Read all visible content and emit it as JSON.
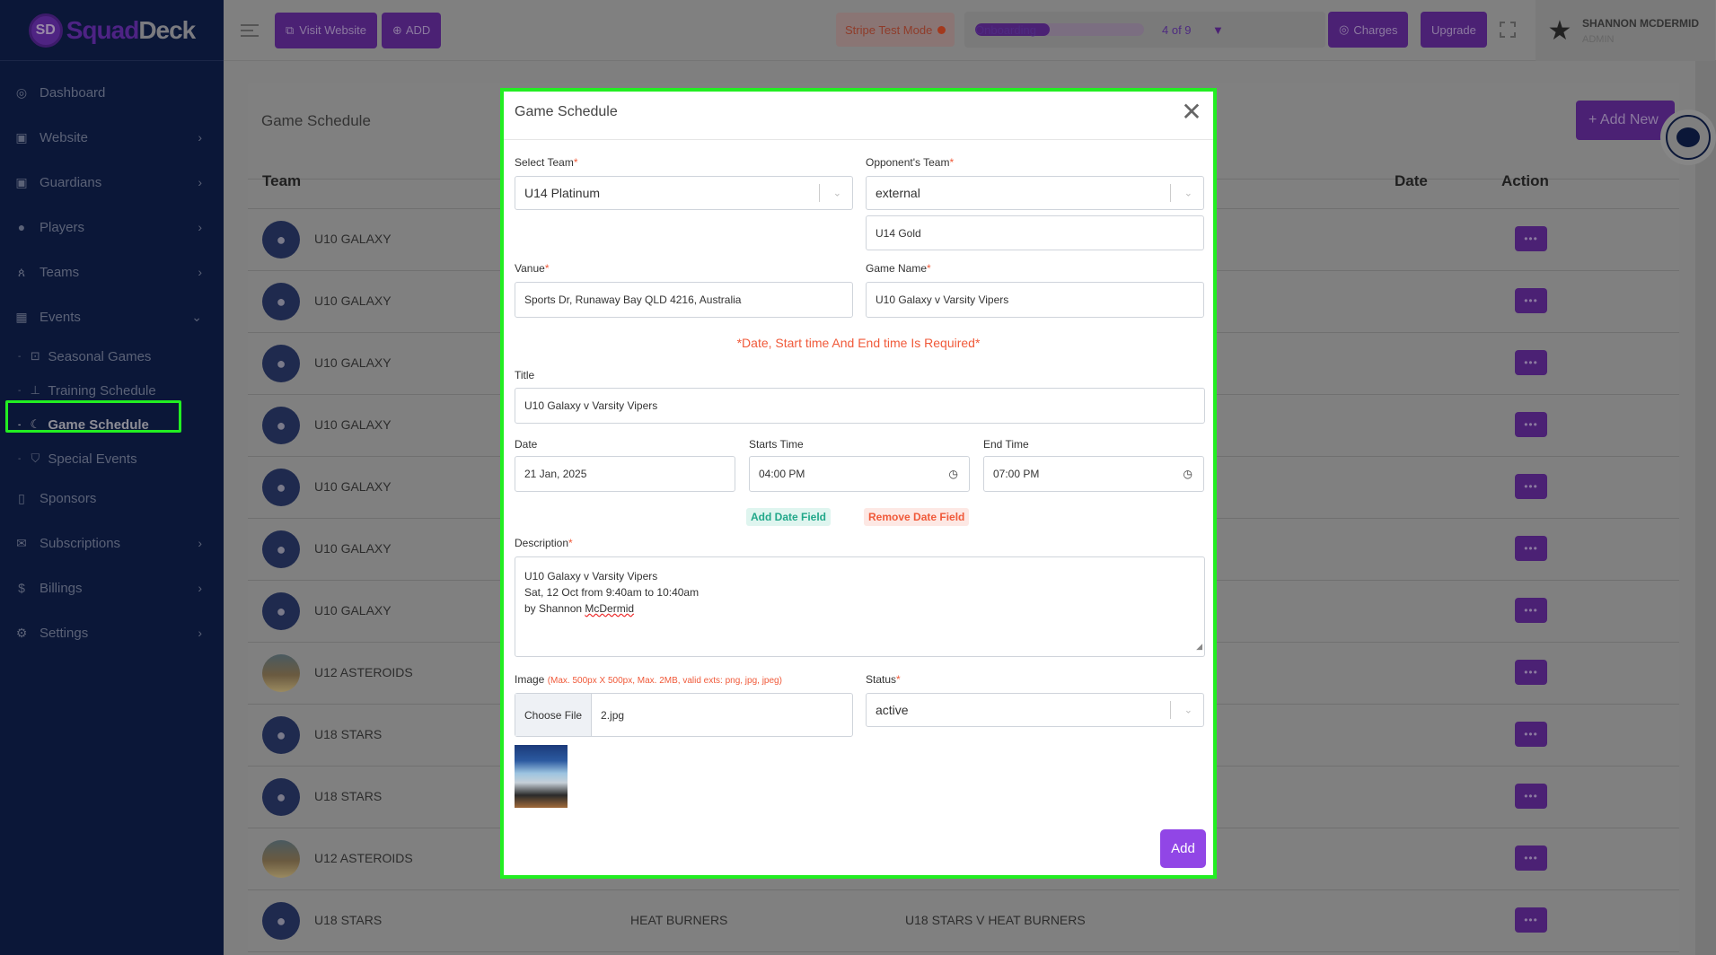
{
  "sidebar": {
    "logo": {
      "mark": "SD",
      "brand_part1": "Squad",
      "brand_part2": "Deck"
    },
    "items": [
      {
        "label": "Dashboard",
        "icon": "gauge-icon",
        "glyph": "◎",
        "chevron": ""
      },
      {
        "label": "Website",
        "icon": "layout-icon",
        "glyph": "▣",
        "chevron": "›"
      },
      {
        "label": "Guardians",
        "icon": "layout-icon",
        "glyph": "▣",
        "chevron": "›"
      },
      {
        "label": "Players",
        "icon": "user-icon",
        "glyph": "●",
        "chevron": "›"
      },
      {
        "label": "Teams",
        "icon": "team-icon",
        "glyph": "ጰ",
        "chevron": "›"
      },
      {
        "label": "Events",
        "icon": "calendar-icon",
        "glyph": "▦",
        "chevron": "⌄"
      }
    ],
    "sub_items": [
      {
        "label": "Seasonal Games",
        "glyph": "⊡",
        "active": false
      },
      {
        "label": "Training Schedule",
        "glyph": "⊥",
        "active": false
      },
      {
        "label": "Game Schedule",
        "glyph": "☾",
        "active": true
      },
      {
        "label": "Special Events",
        "glyph": "⛉",
        "active": false
      }
    ],
    "items_after": [
      {
        "label": "Sponsors",
        "glyph": "▯",
        "chevron": ""
      },
      {
        "label": "Subscriptions",
        "glyph": "✉",
        "chevron": "›"
      },
      {
        "label": "Billings",
        "glyph": "$",
        "chevron": "›"
      },
      {
        "label": "Settings",
        "glyph": "⚙",
        "chevron": "›"
      }
    ],
    "sub_dash": "-"
  },
  "topbar": {
    "visit_website": "Visit Website",
    "visit_icon": "⧉",
    "add": "ADD",
    "add_icon": "⊕",
    "stripe_mode": "Stripe Test Mode",
    "onboarding_label": "Onboarding",
    "onboarding_progress": 0.44,
    "onboarding_count": "4 of 9",
    "onboarding_toggle": "▼",
    "charges": "Charges",
    "charges_icon": "◎",
    "upgrade": "Upgrade",
    "user_name": "SHANNON MCDERMID",
    "user_role": "ADMIN",
    "user_avatar": "★"
  },
  "page": {
    "title": "Game Schedule",
    "add_new": "+  Add New",
    "columns": {
      "team": "Team",
      "date": "Date",
      "action": "Action"
    },
    "action_label": "•••",
    "rows": [
      {
        "team": "U10 GALAXY",
        "opponent": "",
        "game": "",
        "photo": false
      },
      {
        "team": "U10 GALAXY",
        "opponent": "",
        "game": "",
        "photo": false
      },
      {
        "team": "U10 GALAXY",
        "opponent": "",
        "game": "",
        "photo": false
      },
      {
        "team": "U10 GALAXY",
        "opponent": "",
        "game": "",
        "photo": false
      },
      {
        "team": "U10 GALAXY",
        "opponent": "",
        "game": "",
        "photo": false
      },
      {
        "team": "U10 GALAXY",
        "opponent": "",
        "game": "",
        "photo": false
      },
      {
        "team": "U10 GALAXY",
        "opponent": "",
        "game": "",
        "photo": false
      },
      {
        "team": "U12 ASTEROIDS",
        "opponent": "",
        "game": "",
        "photo": true
      },
      {
        "team": "U18 STARS",
        "opponent": "",
        "game": "",
        "photo": false
      },
      {
        "team": "U18 STARS",
        "opponent": "",
        "game": "",
        "photo": false
      },
      {
        "team": "U12 ASTEROIDS",
        "opponent": "",
        "game": "",
        "photo": true
      },
      {
        "team": "U18 STARS",
        "opponent": "HEAT BURNERS",
        "game": "U18 STARS V HEAT BURNERS",
        "photo": false
      }
    ]
  },
  "modal": {
    "title": "Game Schedule",
    "close": "✕",
    "select_team_label": "Select Team",
    "select_team_value": "U14 Platinum",
    "opponent_label": "Opponent's Team",
    "opponent_value": "external",
    "opponent_name_value": "U14 Gold",
    "venue_label": "Vanue",
    "venue_value": "Sports Dr, Runaway Bay QLD 4216, Australia",
    "game_name_label": "Game Name",
    "game_name_value": "U10 Galaxy v Varsity Vipers",
    "error": "*Date, Start time And End time Is Required*",
    "title_label": "Title",
    "title_value": "U10 Galaxy v Varsity Vipers",
    "date_label": "Date",
    "date_value": "21 Jan, 2025",
    "start_label": "Starts Time",
    "start_value": "04:00  PM",
    "end_label": "End Time",
    "end_value": "07:00  PM",
    "add_date": "Add Date Field",
    "remove_date": "Remove Date Field",
    "description_label": "Description",
    "description_lines": [
      "U10 Galaxy v Varsity Vipers",
      "Sat, 12 Oct from 9:40am to 10:40am",
      "by Shannon "
    ],
    "description_misspelled": "McDermid",
    "image_label": "Image",
    "image_hint": "(Max. 500px X 500px, Max. 2MB, valid exts: png, jpg, jpeg)",
    "choose_file": "Choose File",
    "file_name": "2.jpg",
    "status_label": "Status",
    "status_value": "active",
    "submit": "Add",
    "required_mark": "*",
    "chevron": "⌄",
    "clock": "◷"
  }
}
